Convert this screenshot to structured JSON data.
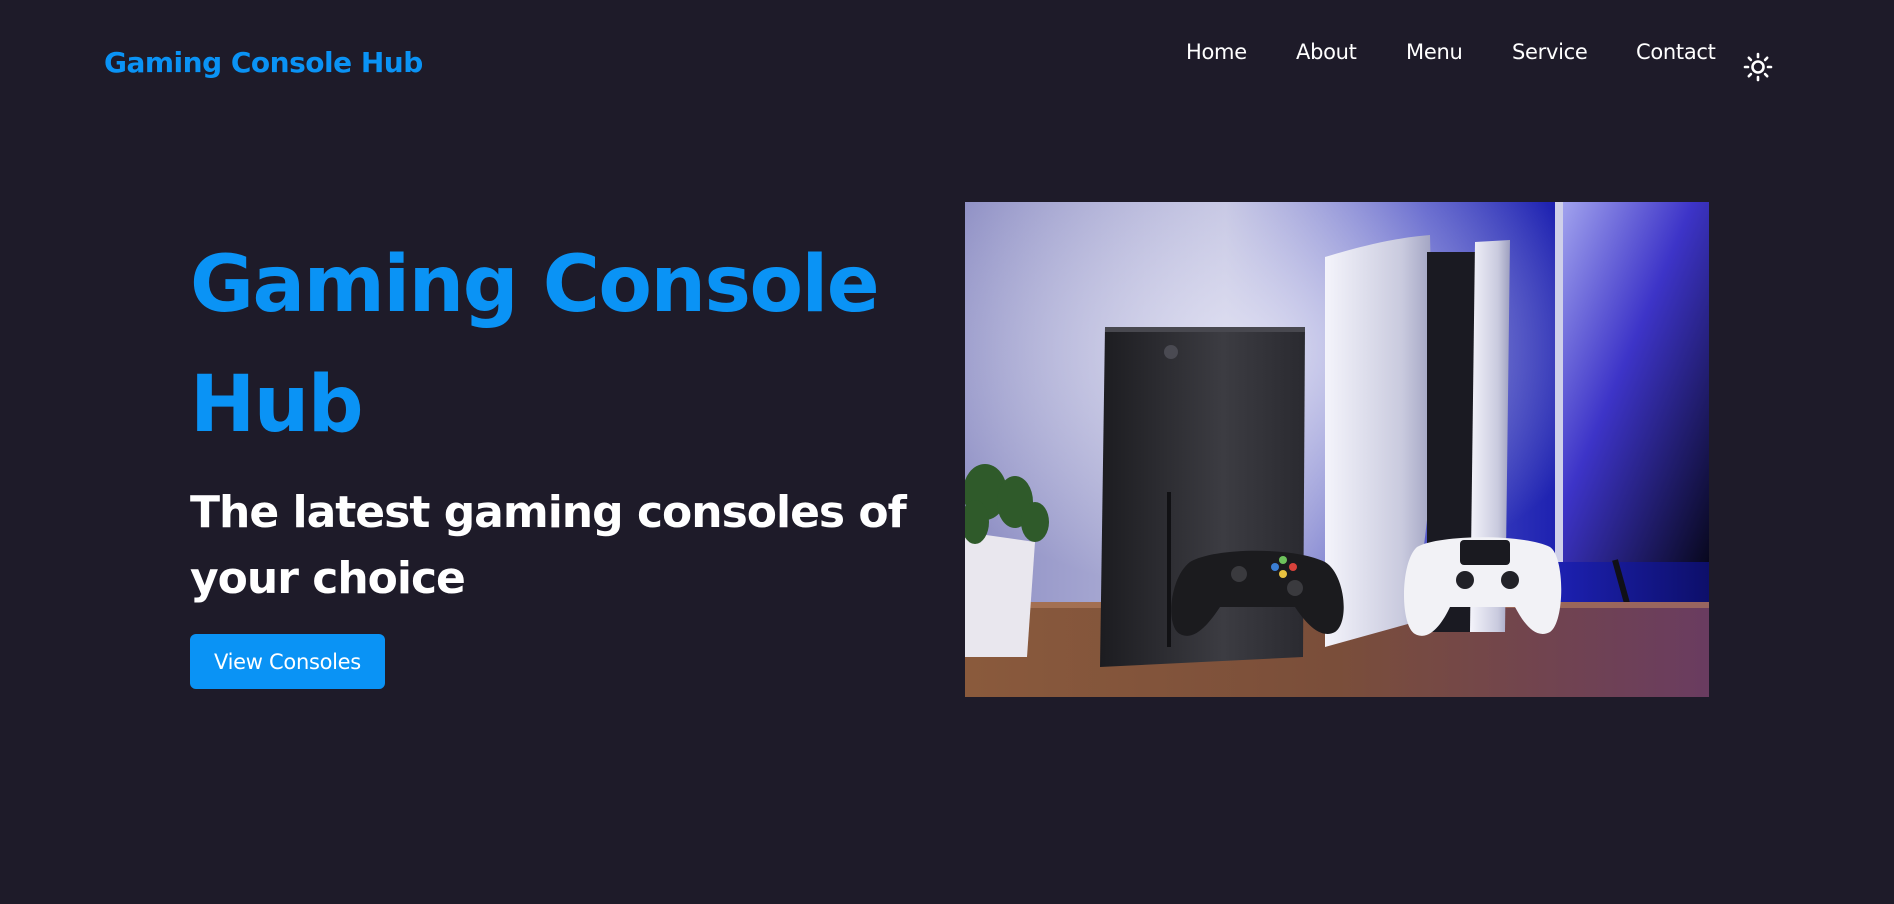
{
  "header": {
    "logo_text": "Gaming Console Hub",
    "nav": {
      "home": "Home",
      "about": "About",
      "menu": "Menu",
      "service": "Service",
      "contact": "Contact"
    },
    "theme_icon": "sun-icon"
  },
  "hero": {
    "title": "Gaming Console Hub",
    "subtitle": "The latest gaming consoles of your choice",
    "button_label": "View Consoles",
    "image_icon": "console-photo"
  },
  "colors": {
    "background": "#1e1b29",
    "accent": "#0a93f5",
    "text": "#ffffff"
  }
}
